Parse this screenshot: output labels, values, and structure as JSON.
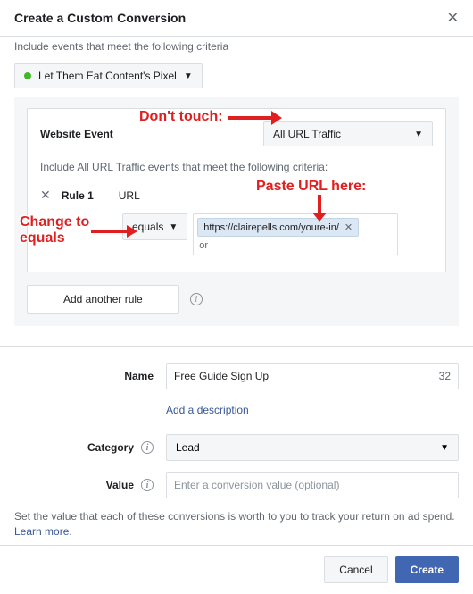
{
  "dialog": {
    "title": "Create a Custom Conversion"
  },
  "body": {
    "cutoff_text": "Include events that meet the following criteria",
    "pixel_select": "Let Them Eat Content's Pixel",
    "website_event_label": "Website Event",
    "website_event_value": "All URL Traffic",
    "include_hint": "Include All URL Traffic events that meet the following criteria:",
    "rule": {
      "name": "Rule 1",
      "type_label": "URL",
      "operator": "equals",
      "value": "https://clairepells.com/youre-in/",
      "or_label": "or"
    },
    "add_another_rule": "Add another rule"
  },
  "form": {
    "name_label": "Name",
    "name_value": "Free Guide Sign Up",
    "name_chars": "32",
    "add_desc": "Add a description",
    "category_label": "Category",
    "category_value": "Lead",
    "value_label": "Value",
    "value_placeholder": "Enter a conversion value (optional)"
  },
  "help": {
    "text": "Set the value that each of these conversions is worth to you to track your return on ad spend. ",
    "learn_more": "Learn more."
  },
  "footer": {
    "cancel": "Cancel",
    "create": "Create"
  },
  "annotations": {
    "dont_touch": "Don't touch:",
    "paste_url": "Paste URL here:",
    "change_equals_1": "Change to",
    "change_equals_2": "equals"
  }
}
